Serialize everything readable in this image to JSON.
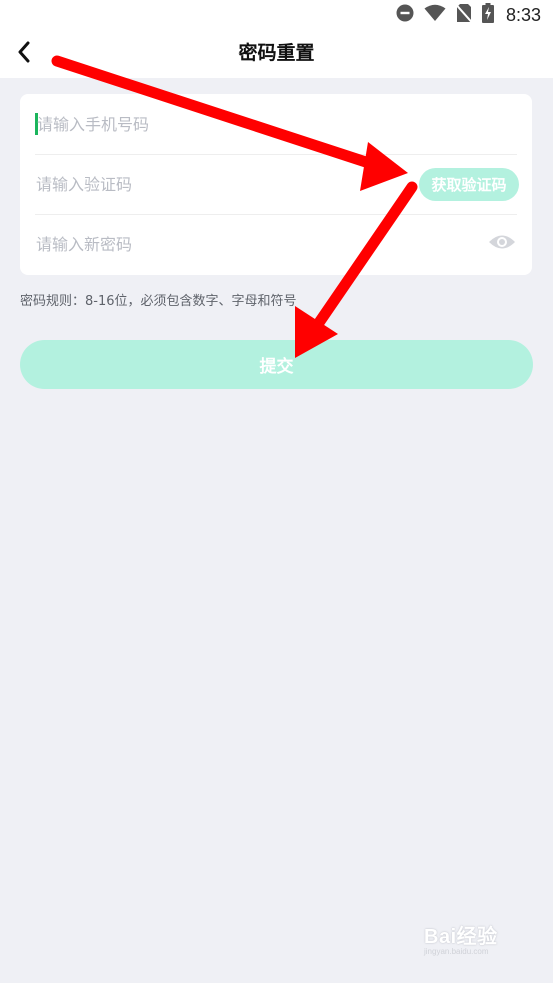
{
  "status_bar": {
    "time": "8:33",
    "icons": [
      "dnd-icon",
      "wifi-icon",
      "no-sim-icon",
      "battery-charging-icon"
    ]
  },
  "header": {
    "back_icon": "chevron-left-icon",
    "title": "密码重置"
  },
  "form": {
    "phone_placeholder": "请输入手机号码",
    "code_placeholder": "请输入验证码",
    "get_code_label": "获取验证码",
    "password_placeholder": "请输入新密码",
    "password_toggle_icon": "eye-icon"
  },
  "rule_hint": "密码规则：8-16位，必须包含数字、字母和符号",
  "submit_label": "提交",
  "watermark": {
    "brand": "Bai经验",
    "sub": "jingyan.baidu.com"
  },
  "colors": {
    "accent_light": "#b3f1df",
    "caret": "#1bb55c",
    "annotation_arrow": "#ff0000",
    "background": "#eff0f5"
  }
}
